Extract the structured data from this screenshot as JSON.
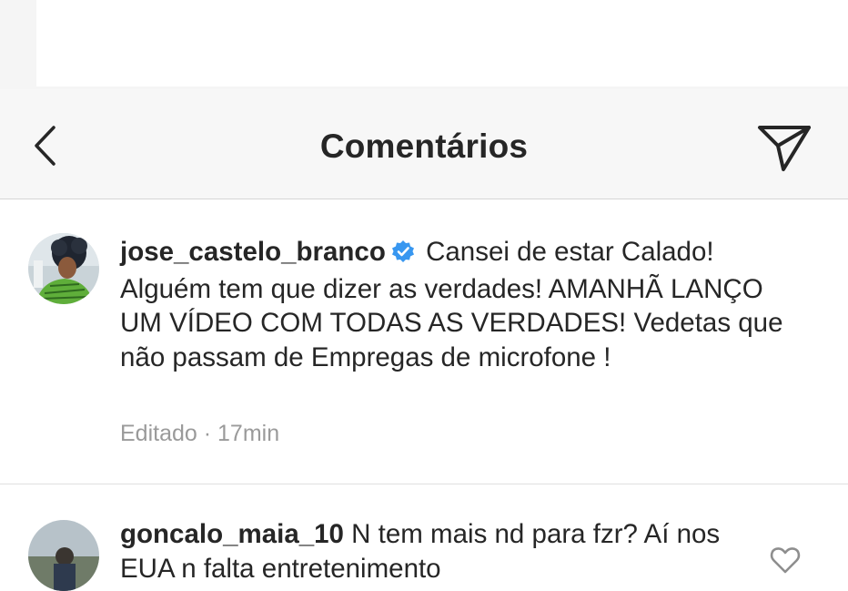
{
  "header": {
    "title": "Comentários"
  },
  "comments": [
    {
      "username": "jose_castelo_branco",
      "verified": true,
      "text": "Cansei de estar Calado! Alguém tem que dizer as verdades! AMANHÃ LANÇO UM VÍDEO COM TODAS AS VERDADES! Vedetas que não passam de Empregas de microfone !",
      "edited_label": "Editado",
      "separator": "·",
      "time": "17min"
    },
    {
      "username": "goncalo_maia_10",
      "verified": false,
      "text": "N tem mais nd para fzr? Aí nos EUA n falta entretenimento"
    }
  ],
  "icons": {
    "back": "chevron-left-icon",
    "send": "paper-plane-icon",
    "verified": "verified-badge-icon",
    "like": "heart-outline-icon"
  },
  "colors": {
    "text": "#262626",
    "meta": "#9a9a9a",
    "verified": "#3897f0",
    "header_bg": "#f7f7f7"
  }
}
